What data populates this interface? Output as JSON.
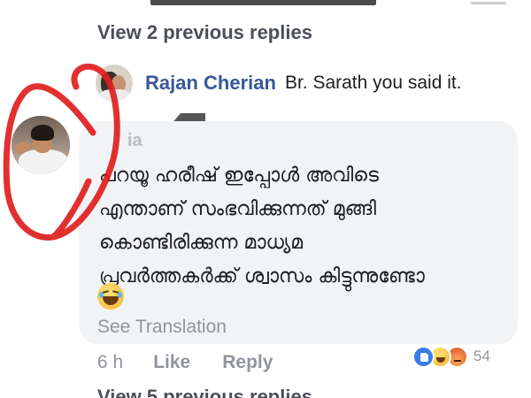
{
  "thread": {
    "view_previous_top": "View 2 previous replies",
    "view_previous_bottom": "View 5 previous replies"
  },
  "reply": {
    "author": "Rajan Cherian",
    "text": "Br. Sarath you said it."
  },
  "comment": {
    "author_partial": "ia",
    "lines": [
      "പറയൂ ഹരീഷ് ഇപ്പോൾ അവിടെ",
      "എന്താണ് സംഭവിക്കുന്നത് മുങ്ങി",
      "കൊണ്ടിരിക്കുന്ന മാധ്യമ",
      "പ്രവർത്തകർക്ക് ശ്വാസം കിട്ടുന്നുണ്ടോ"
    ],
    "emoji": "laughing-with-tears-emoji",
    "see_translation": "See Translation",
    "time": "6 h",
    "like_label": "Like",
    "reply_label": "Reply",
    "reaction_icons": [
      "like-reaction",
      "haha-reaction",
      "angry-reaction"
    ],
    "reaction_count": "54"
  },
  "colors": {
    "name_link": "#385898",
    "meta_gray": "#90949c",
    "bubble_bg": "#f2f3f5",
    "annotation_red": "#e01e1e"
  }
}
